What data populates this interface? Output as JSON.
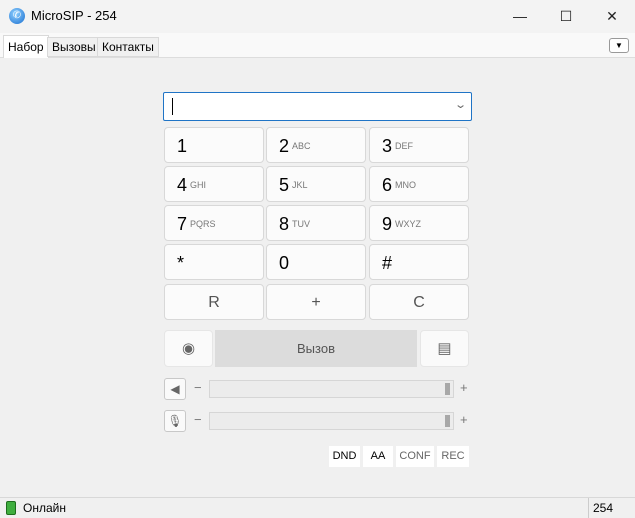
{
  "window": {
    "title": "MicroSIP - 254",
    "minimize": "—",
    "maximize": "☐",
    "close": "✕"
  },
  "tabs": [
    {
      "label": "Набор"
    },
    {
      "label": "Вызовы"
    },
    {
      "label": "Контакты"
    }
  ],
  "tab_menu": "▼",
  "dial_input": {
    "value": "",
    "dropdown": "⌄"
  },
  "keypad": [
    {
      "digit": "1",
      "letters": ""
    },
    {
      "digit": "2",
      "letters": "ABC"
    },
    {
      "digit": "3",
      "letters": "DEF"
    },
    {
      "digit": "4",
      "letters": "GHI"
    },
    {
      "digit": "5",
      "letters": "JKL"
    },
    {
      "digit": "6",
      "letters": "MNO"
    },
    {
      "digit": "7",
      "letters": "PQRS"
    },
    {
      "digit": "8",
      "letters": "TUV"
    },
    {
      "digit": "9",
      "letters": "WXYZ"
    },
    {
      "digit": "*",
      "letters": ""
    },
    {
      "digit": "0",
      "letters": ""
    },
    {
      "digit": "#",
      "letters": ""
    }
  ],
  "actions": {
    "redial": "R",
    "plus": "+",
    "clear": "C"
  },
  "call": {
    "label": "Вызов",
    "video_icon": "webcam-icon",
    "message_icon": "message-icon"
  },
  "volume": {
    "minus": "−",
    "plus": "+",
    "speaker_level": 1.0,
    "mic_level": 1.0
  },
  "options": {
    "dnd": "DND",
    "aa": "AA",
    "conf": "CONF",
    "rec": "REC"
  },
  "status": {
    "text": "Онлайн",
    "account": "254",
    "color": "#3fae3f"
  }
}
